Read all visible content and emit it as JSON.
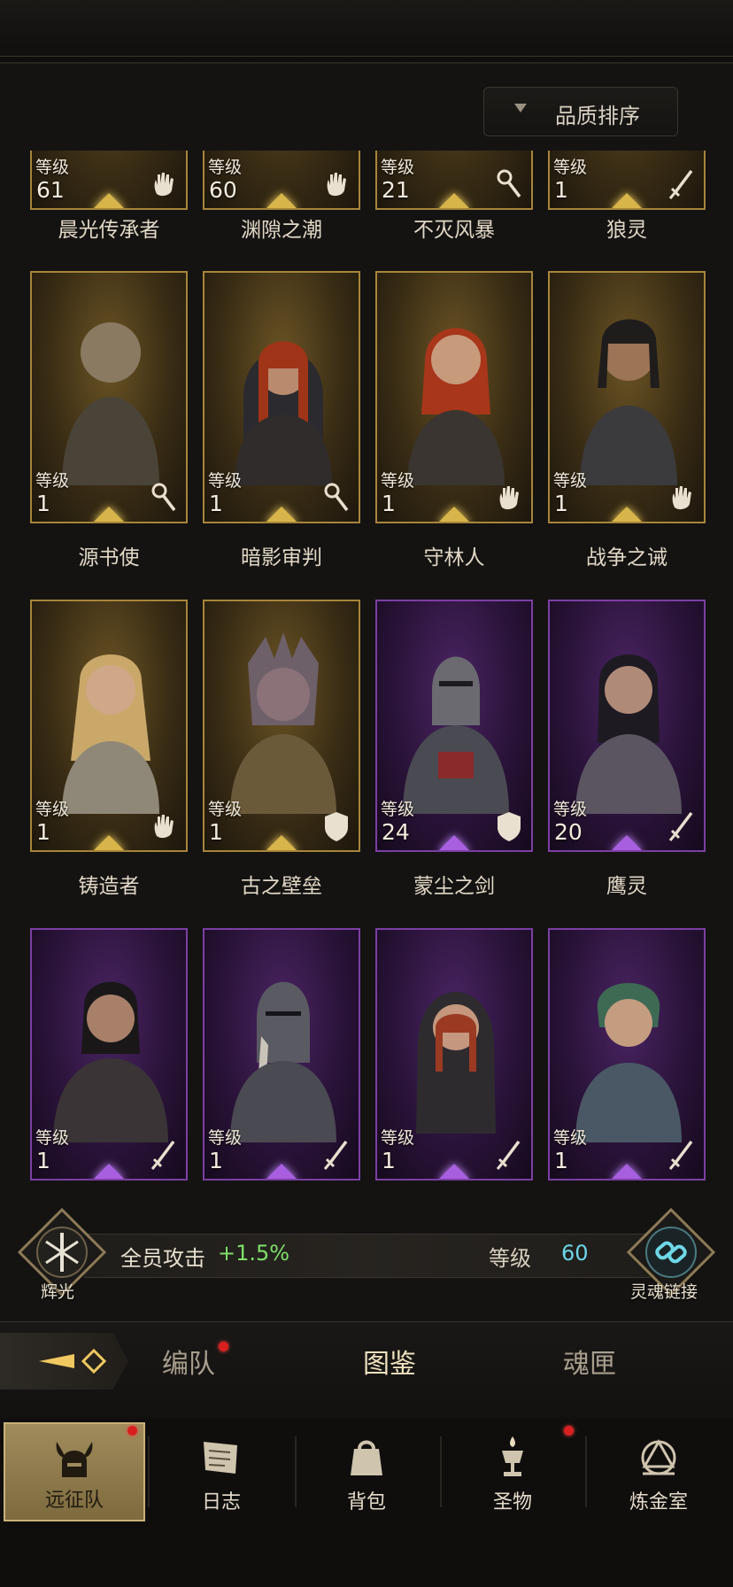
{
  "sort": {
    "label": "品质排序"
  },
  "level_label": "等级",
  "top_row": [
    {
      "name": "晨光传承者",
      "level": "61",
      "class_icon": "hand-icon",
      "rarity": "gold"
    },
    {
      "name": "渊隙之潮",
      "level": "60",
      "class_icon": "hand-icon",
      "rarity": "gold"
    },
    {
      "name": "不灭风暴",
      "level": "21",
      "class_icon": "staff-icon",
      "rarity": "gold"
    },
    {
      "name": "狼灵",
      "level": "1",
      "class_icon": "sword-icon",
      "rarity": "gold"
    }
  ],
  "rows": [
    [
      {
        "name": "源书使",
        "level": "1",
        "class_icon": "staff-icon",
        "rarity": "gold"
      },
      {
        "name": "暗影审判",
        "level": "1",
        "class_icon": "staff-icon",
        "rarity": "gold"
      },
      {
        "name": "守林人",
        "level": "1",
        "class_icon": "hand-icon",
        "rarity": "gold"
      },
      {
        "name": "战争之诫",
        "level": "1",
        "class_icon": "hand-icon",
        "rarity": "gold"
      }
    ],
    [
      {
        "name": "铸造者",
        "level": "1",
        "class_icon": "hand-icon",
        "rarity": "gold"
      },
      {
        "name": "古之壁垒",
        "level": "1",
        "class_icon": "shield-icon",
        "rarity": "gold"
      },
      {
        "name": "蒙尘之剑",
        "level": "24",
        "class_icon": "shield-icon",
        "rarity": "purple"
      },
      {
        "name": "鹰灵",
        "level": "20",
        "class_icon": "sword-icon",
        "rarity": "purple"
      }
    ],
    [
      {
        "name": "",
        "level": "1",
        "class_icon": "sword-icon",
        "rarity": "purple"
      },
      {
        "name": "",
        "level": "1",
        "class_icon": "sword-icon",
        "rarity": "purple"
      },
      {
        "name": "",
        "level": "1",
        "class_icon": "sword-icon",
        "rarity": "purple"
      },
      {
        "name": "",
        "level": "1",
        "class_icon": "sword-icon",
        "rarity": "purple"
      }
    ]
  ],
  "bonus": {
    "radiance_label": "辉光",
    "attack_text": "全员攻击",
    "attack_value": "+1.5%",
    "level_text": "等级",
    "level_value": "60",
    "soul_link_label": "灵魂链接"
  },
  "tabs": [
    {
      "label": "编队",
      "has_dot": true
    },
    {
      "label": "图鉴",
      "active": true
    },
    {
      "label": "魂匣"
    }
  ],
  "nav": [
    {
      "label": "远征队",
      "icon": "horned-helmet-icon",
      "active": true,
      "has_dot": true
    },
    {
      "label": "日志",
      "icon": "scroll-icon"
    },
    {
      "label": "背包",
      "icon": "bag-icon"
    },
    {
      "label": "圣物",
      "icon": "chalice-icon",
      "has_dot": true
    },
    {
      "label": "炼金室",
      "icon": "alchemy-icon"
    }
  ],
  "colors": {
    "gold_frame": "#a7853a",
    "purple_frame": "#7b3fa3",
    "bonus_green": "#7fe06a",
    "level_cyan": "#6dd7e8",
    "badge_red": "#d82020"
  }
}
